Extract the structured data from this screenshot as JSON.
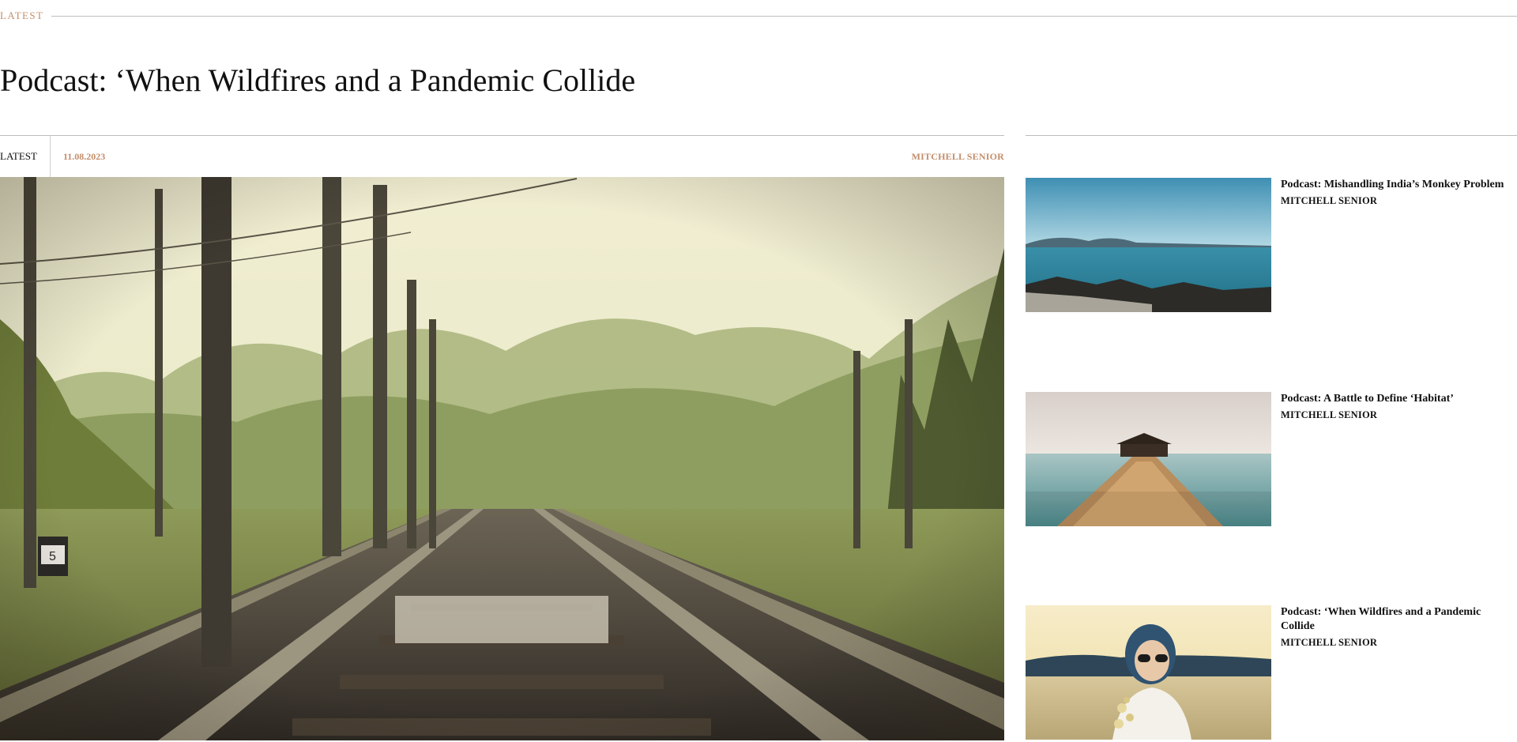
{
  "section": {
    "label": "LATEST"
  },
  "article": {
    "headline": "Podcast: ‘When Wildfires and a Pandemic Collide",
    "category": "LATEST",
    "date": "11.08.2023",
    "author": "MITCHELL SENIOR",
    "image_alt": "Railway tracks stretching through a forest"
  },
  "sidebar": {
    "items": [
      {
        "title": "Podcast: Mishandling India’s Monkey Problem",
        "author": "MITCHELL SENIOR",
        "image_alt": "Sea coast with rocks and mountains"
      },
      {
        "title": "Podcast: A Battle to Define ‘Habitat’",
        "author": "MITCHELL SENIOR",
        "image_alt": "Wooden pier leading to a gazebo over water"
      },
      {
        "title": "Podcast: ‘When Wildfires and a Pandemic Collide",
        "author": "MITCHELL SENIOR",
        "image_alt": "Woman in sunglasses holding flowers in a field"
      }
    ]
  },
  "colors": {
    "accent": "#c48e6c",
    "rule": "#bdbdbd",
    "text": "#111111"
  }
}
